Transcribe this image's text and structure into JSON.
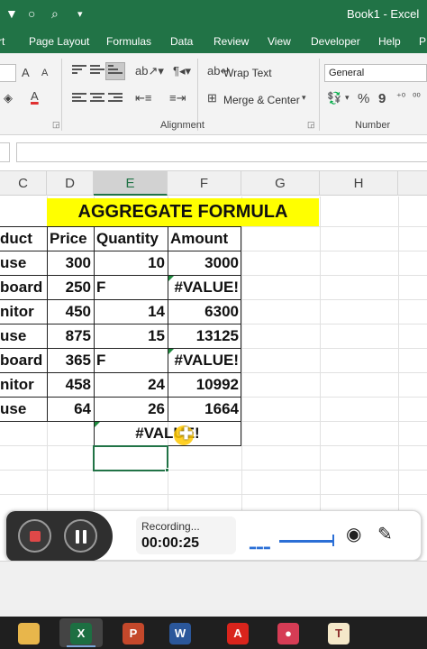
{
  "window": {
    "title": "Book1  -  Excel"
  },
  "quick_access": {
    "filter_icon": "▼",
    "circle_icon": "○",
    "preview_icon": "⌕",
    "more_icon": "▾"
  },
  "menu_tabs": [
    "rt",
    "Page Layout",
    "Formulas",
    "Data",
    "Review",
    "View",
    "Developer",
    "Help",
    "P"
  ],
  "ribbon": {
    "wrap_text": "Wrap Text",
    "merge_center": "Merge & Center",
    "number_format": "General",
    "alignment_label": "Alignment",
    "number_label": "Number",
    "percent": "%",
    "comma": "9",
    "font_color_letter": "A",
    "grow_font": "A",
    "shrink_font": "A"
  },
  "columns": [
    "C",
    "D",
    "E",
    "F",
    "G",
    "H"
  ],
  "selected_column": "E",
  "sheet": {
    "title": "AGGREGATE FORMULA",
    "headers": [
      "duct",
      "Price",
      "Quantity",
      "Amount"
    ],
    "rows": [
      {
        "product": "use",
        "price": "300",
        "quantity": "10",
        "amount": "3000"
      },
      {
        "product": "board",
        "price": "250",
        "quantity": "F",
        "amount": "#VALUE!"
      },
      {
        "product": "nitor",
        "price": "450",
        "quantity": "14",
        "amount": "6300"
      },
      {
        "product": "use",
        "price": "875",
        "quantity": "15",
        "amount": "13125"
      },
      {
        "product": "board",
        "price": "365",
        "quantity": "F",
        "amount": "#VALUE!"
      },
      {
        "product": "nitor",
        "price": "458",
        "quantity": "24",
        "amount": "10992"
      },
      {
        "product": "use",
        "price": "64",
        "quantity": "26",
        "amount": "1664"
      }
    ],
    "aggregate_result": "#VALUE!"
  },
  "recorder": {
    "label": "Recording...",
    "time": "00:00:25"
  },
  "taskbar": {
    "apps": [
      {
        "name": "file-explorer",
        "glyph": ""
      },
      {
        "name": "excel",
        "glyph": "X"
      },
      {
        "name": "powerpoint",
        "glyph": "P"
      },
      {
        "name": "word",
        "glyph": "W"
      },
      {
        "name": "acrobat",
        "glyph": "A"
      },
      {
        "name": "screen-recorder",
        "glyph": "●"
      },
      {
        "name": "tally",
        "glyph": "T"
      }
    ]
  },
  "colors": {
    "excel_green": "#217346",
    "title_fill": "#ffff00",
    "record_red": "#e04848"
  }
}
